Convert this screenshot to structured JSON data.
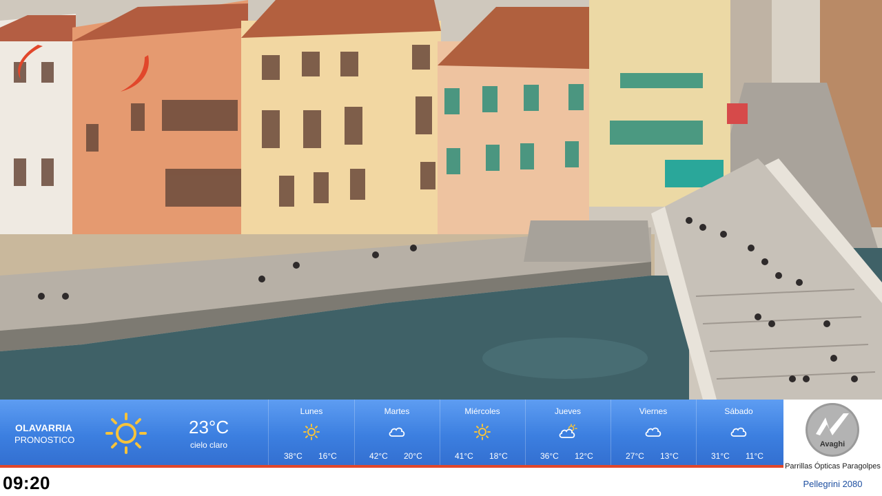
{
  "weather": {
    "city": "OLAVARRIA",
    "label": "PRONOSTICO",
    "current_temp": "23°C",
    "current_desc": "cielo claro",
    "current_icon": "sun-icon",
    "days": [
      {
        "name": "Lunes",
        "icon": "sun-icon",
        "max": "38°C",
        "min": "16°C"
      },
      {
        "name": "Martes",
        "icon": "cloud-icon",
        "max": "42°C",
        "min": "20°C"
      },
      {
        "name": "Miércoles",
        "icon": "sun-icon",
        "max": "41°C",
        "min": "18°C"
      },
      {
        "name": "Jueves",
        "icon": "sun-cloud-icon",
        "max": "36°C",
        "min": "12°C"
      },
      {
        "name": "Viernes",
        "icon": "cloud-icon",
        "max": "27°C",
        "min": "13°C"
      },
      {
        "name": "Sábado",
        "icon": "cloud-icon",
        "max": "31°C",
        "min": "11°C"
      }
    ]
  },
  "clock": "09:20",
  "sponsor": {
    "logo_text": "Avaghi",
    "line1": "Parrillas Ópticas Paragolpes",
    "line2": "Pellegrini  2080"
  },
  "colors": {
    "bar_blue": "#3c7fe0",
    "accent_red": "#e1472b",
    "sun_yellow": "#f6c33b",
    "sponsor_blue": "#1c4ea0"
  }
}
